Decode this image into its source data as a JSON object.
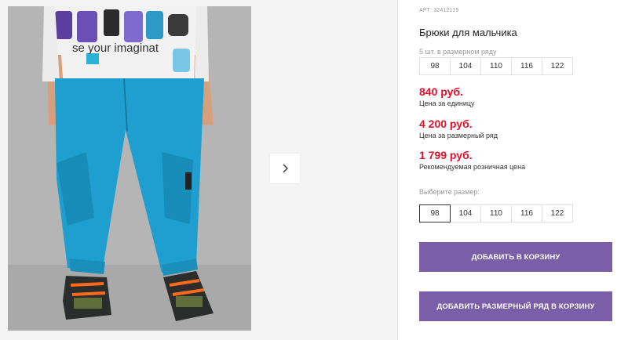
{
  "product": {
    "article": "АРТ: 32412119",
    "title": "Брюки для мальчика",
    "shirt_print_text": "se your imaginat"
  },
  "size_row": {
    "label": "5 шт. в размерном ряду",
    "sizes": [
      "98",
      "104",
      "110",
      "116",
      "122"
    ]
  },
  "prices": {
    "unit_price": "840 руб.",
    "unit_label": "Цена за единицу",
    "row_price": "4 200 руб.",
    "row_label": "Цена за размерный ряд",
    "retail_price": "1 799 руб.",
    "retail_label": "Рекомендуемая розничная цена"
  },
  "size_select": {
    "label": "Выберите размер:",
    "sizes": [
      "98",
      "104",
      "110",
      "116",
      "122"
    ],
    "selected": "98"
  },
  "actions": {
    "add_to_cart": "ДОБАВИТЬ В КОРЗИНУ",
    "add_row_to_cart": "ДОБАВИТЬ РАЗМЕРНЫЙ РЯД В КОРЗИНУ"
  },
  "colors": {
    "accent_button": "#7b5ea8",
    "price_red": "#e0122b",
    "pants_blue": "#1f9fcf"
  },
  "icons": {
    "next": "chevron-right-icon"
  }
}
